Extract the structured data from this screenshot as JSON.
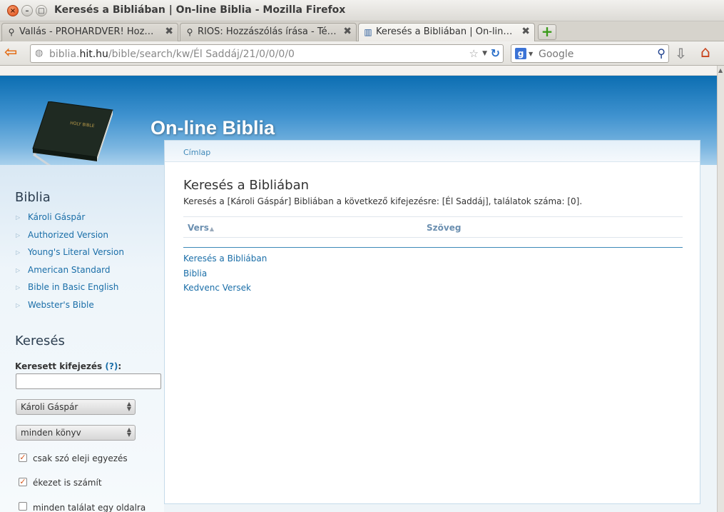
{
  "window": {
    "title": "Keresés a Bibliában | On-line Biblia - Mozilla Firefox"
  },
  "tabs": [
    {
      "label": "Vallás - PROHARDVER! Hoz…",
      "icon": "search-favicon-icon",
      "active": false
    },
    {
      "label": "RIOS: Hozzászólás írása - Té…",
      "icon": "search-favicon-icon",
      "active": false
    },
    {
      "label": "Keresés a Bibliában | On-lin…",
      "icon": "book-favicon-icon",
      "active": true
    }
  ],
  "navbar": {
    "url_prefix": "biblia.",
    "url_host": "hit.hu",
    "url_path": "/bible/search/kw/Él Saddáj/21/0/0/0/0",
    "search_placeholder": "Google"
  },
  "site": {
    "name": "On-line Biblia"
  },
  "breadcrumb": {
    "home": "Címlap"
  },
  "main": {
    "title": "Keresés a Bibliában",
    "summary": "Keresés a [Károli Gáspár] Bibliában a következő kifejezésre: [Él Saddáj], találatok száma: [0].",
    "columns": {
      "verse": "Vers",
      "text": "Szöveg"
    },
    "links": [
      "Keresés a Bibliában",
      "Biblia",
      "Kedvenc Versek"
    ]
  },
  "sidebar": {
    "bible_heading": "Biblia",
    "versions": [
      "Károli Gáspár",
      "Authorized Version",
      "Young's Literal Version",
      "American Standard",
      "Bible in Basic English",
      "Webster's Bible"
    ],
    "search_heading": "Keresés",
    "search_label": "Keresett kifejezés",
    "search_help": "(?)",
    "search_colon": ":",
    "search_value": "",
    "translation_select": "Károli Gáspár",
    "book_select": "minden könyv",
    "options": [
      {
        "label": "csak szó eleji egyezés",
        "checked": true
      },
      {
        "label": "ékezet is számít",
        "checked": true
      },
      {
        "label": "minden találat egy oldalra",
        "checked": false
      }
    ]
  },
  "colors": {
    "header_blue": "#0c6eb2",
    "link": "#1a6ea8",
    "accent_orange": "#d5561a"
  }
}
